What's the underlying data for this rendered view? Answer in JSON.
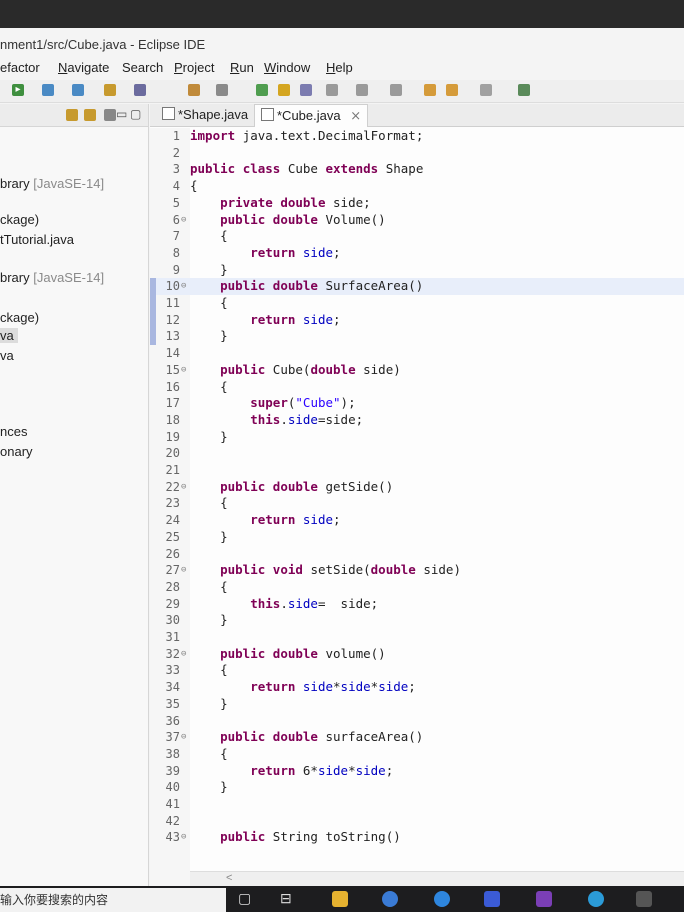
{
  "window": {
    "title": "nment1/src/Cube.java - Eclipse IDE"
  },
  "menu": [
    {
      "label": "efactor",
      "underline": ""
    },
    {
      "label": "Navigate",
      "underline": "N"
    },
    {
      "label": "Search",
      "underline": ""
    },
    {
      "label": "Project",
      "underline": "P"
    },
    {
      "label": "Run",
      "underline": "R"
    },
    {
      "label": "Window",
      "underline": "W"
    },
    {
      "label": "Help",
      "underline": "H"
    }
  ],
  "package_explorer": {
    "items": [
      {
        "label": "brary",
        "dim": " [JavaSE-14]"
      },
      {
        "label": "ckage)",
        "dim": ""
      },
      {
        "label": "tTutorial.java",
        "dim": ""
      },
      {
        "label": "brary",
        "dim": " [JavaSE-14]"
      },
      {
        "label": "ckage)",
        "dim": ""
      },
      {
        "label": "va",
        "dim": ""
      },
      {
        "label": "va",
        "dim": ""
      },
      {
        "label": "nces",
        "dim": ""
      },
      {
        "label": "onary",
        "dim": ""
      }
    ]
  },
  "editor": {
    "tabs": [
      {
        "label": "*Shape.java"
      },
      {
        "label": "*Cube.java",
        "close": "⨯"
      }
    ],
    "lines": [
      {
        "num": "1",
        "fold": "",
        "text": "import java.text.DecimalFormat;"
      },
      {
        "num": "2",
        "fold": "",
        "text": ""
      },
      {
        "num": "3",
        "fold": "",
        "text": "public class Cube extends Shape"
      },
      {
        "num": "4",
        "fold": "",
        "text": "{"
      },
      {
        "num": "5",
        "fold": "",
        "text": "    private double side;"
      },
      {
        "num": "6",
        "fold": "⊖",
        "text": "    public double Volume()"
      },
      {
        "num": "7",
        "fold": "",
        "text": "    {"
      },
      {
        "num": "8",
        "fold": "",
        "text": "        return side;"
      },
      {
        "num": "9",
        "fold": "",
        "text": "    }"
      },
      {
        "num": "10",
        "fold": "⊖",
        "text": "    public double SurfaceArea()"
      },
      {
        "num": "11",
        "fold": "",
        "text": "    {"
      },
      {
        "num": "12",
        "fold": "",
        "text": "        return side;"
      },
      {
        "num": "13",
        "fold": "",
        "text": "    }"
      },
      {
        "num": "14",
        "fold": "",
        "text": ""
      },
      {
        "num": "15",
        "fold": "⊖",
        "text": "    public Cube(double side)"
      },
      {
        "num": "16",
        "fold": "",
        "text": "    {"
      },
      {
        "num": "17",
        "fold": "",
        "text": "        super(\"Cube\");"
      },
      {
        "num": "18",
        "fold": "",
        "text": "        this.side=side;"
      },
      {
        "num": "19",
        "fold": "",
        "text": "    }"
      },
      {
        "num": "20",
        "fold": "",
        "text": ""
      },
      {
        "num": "21",
        "fold": "",
        "text": ""
      },
      {
        "num": "22",
        "fold": "⊖",
        "text": "    public double getSide()"
      },
      {
        "num": "23",
        "fold": "",
        "text": "    {"
      },
      {
        "num": "24",
        "fold": "",
        "text": "        return side;"
      },
      {
        "num": "25",
        "fold": "",
        "text": "    }"
      },
      {
        "num": "26",
        "fold": "",
        "text": ""
      },
      {
        "num": "27",
        "fold": "⊖",
        "text": "    public void setSide(double side)"
      },
      {
        "num": "28",
        "fold": "",
        "text": "    {"
      },
      {
        "num": "29",
        "fold": "",
        "text": "        this.side=  side;"
      },
      {
        "num": "30",
        "fold": "",
        "text": "    }"
      },
      {
        "num": "31",
        "fold": "",
        "text": ""
      },
      {
        "num": "32",
        "fold": "⊖",
        "text": "    public double volume()"
      },
      {
        "num": "33",
        "fold": "",
        "text": "    {"
      },
      {
        "num": "34",
        "fold": "",
        "text": "        return side*side*side;"
      },
      {
        "num": "35",
        "fold": "",
        "text": "    }"
      },
      {
        "num": "36",
        "fold": "",
        "text": ""
      },
      {
        "num": "37",
        "fold": "⊖",
        "text": "    public double surfaceArea()"
      },
      {
        "num": "38",
        "fold": "",
        "text": "    {"
      },
      {
        "num": "39",
        "fold": "",
        "text": "        return 6*side*side;"
      },
      {
        "num": "40",
        "fold": "",
        "text": "    }"
      },
      {
        "num": "41",
        "fold": "",
        "text": ""
      },
      {
        "num": "42",
        "fold": "",
        "text": ""
      },
      {
        "num": "43",
        "fold": "⊖",
        "text": "    public String toString()"
      }
    ],
    "current_line": "10",
    "keyword_color": "#7f0055",
    "field_color": "#0000c0",
    "string_color": "#2a00ff"
  },
  "scrollbar": {
    "left_arrow": "<"
  },
  "taskbar": {
    "search_placeholder": "输入你要搜索的内容"
  }
}
